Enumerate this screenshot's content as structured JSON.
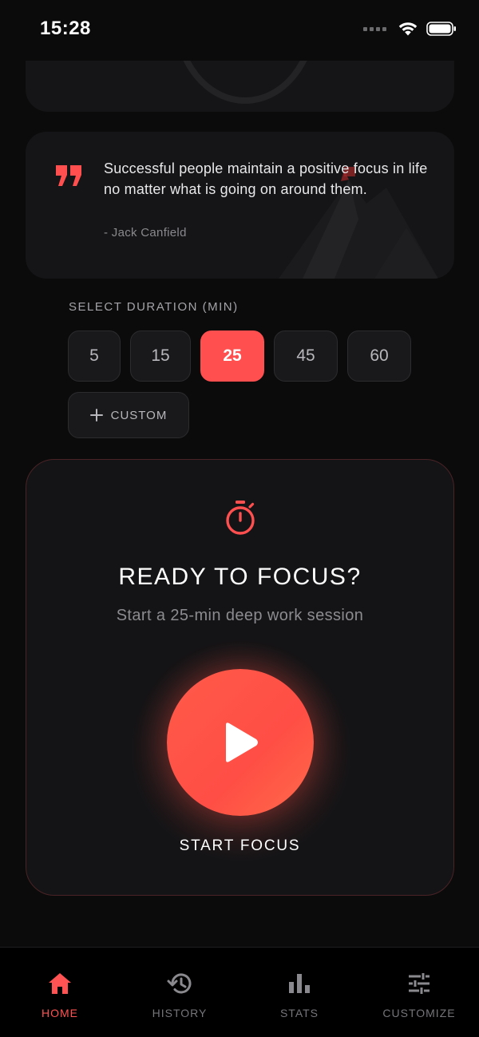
{
  "status_bar": {
    "time": "15:28"
  },
  "quote": {
    "text": "Successful people maintain a positive focus in life no matter what is going on around them.",
    "author": "- Jack Canfield"
  },
  "duration": {
    "label": "SELECT DURATION (MIN)",
    "options": [
      "5",
      "15",
      "25",
      "45",
      "60"
    ],
    "selected": "25",
    "custom_label": "CUSTOM"
  },
  "focus": {
    "title": "READY TO FOCUS?",
    "subtitle": "Start a 25-min deep work session",
    "start_label": "START FOCUS"
  },
  "nav": {
    "items": [
      {
        "label": "HOME",
        "icon": "home-icon",
        "active": true
      },
      {
        "label": "HISTORY",
        "icon": "history-icon",
        "active": false
      },
      {
        "label": "STATS",
        "icon": "stats-icon",
        "active": false
      },
      {
        "label": "CUSTOMIZE",
        "icon": "sliders-icon",
        "active": false
      }
    ]
  },
  "colors": {
    "accent": "#ff4f4f",
    "background": "#0b0b0c",
    "card": "#151517"
  }
}
